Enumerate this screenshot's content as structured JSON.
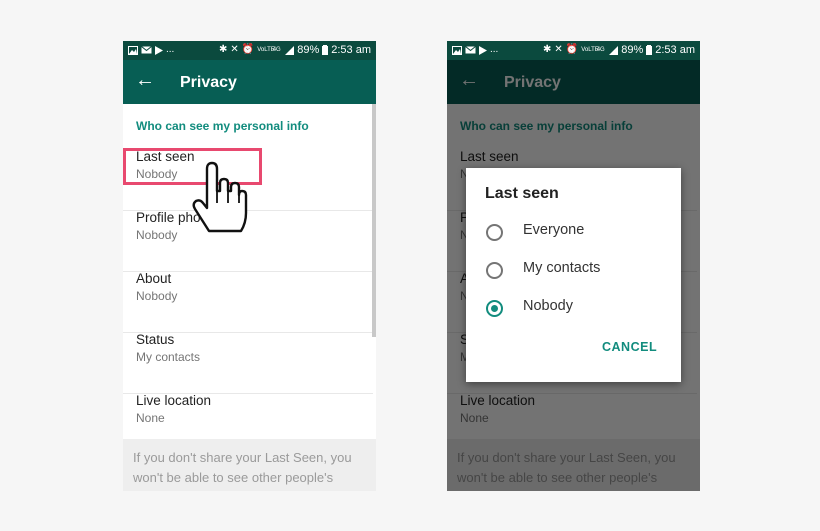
{
  "status_bar": {
    "battery": "89%",
    "time": "2:53 am",
    "left_icons": [
      "image-icon",
      "mail-icon",
      "play-store-icon"
    ],
    "overflow": "...",
    "right_icons": [
      "bluetooth-icon",
      "mute-icon",
      "alarm-icon",
      "volte-icon",
      "4g-icon",
      "signal-icon",
      "battery-icon"
    ],
    "volte": "VoLTE",
    "network": "4G"
  },
  "toolbar": {
    "title": "Privacy",
    "back_icon": "arrow-left-icon"
  },
  "privacy": {
    "section_header": "Who can see my personal info",
    "settings": [
      {
        "title": "Last seen",
        "value": "Nobody"
      },
      {
        "title": "Profile photo",
        "value": "Nobody"
      },
      {
        "title": "About",
        "value": "Nobody"
      },
      {
        "title": "Status",
        "value": "My contacts"
      },
      {
        "title": "Live location",
        "value": "None"
      }
    ],
    "footer_note": "If you don't share your Last Seen, you won't be able to see other people's"
  },
  "dialog": {
    "title": "Last seen",
    "options": [
      {
        "label": "Everyone",
        "selected": false
      },
      {
        "label": "My contacts",
        "selected": false
      },
      {
        "label": "Nobody",
        "selected": true
      }
    ],
    "cancel_label": "CANCEL"
  },
  "colors": {
    "status_bar": "#0b4a3e",
    "toolbar": "#075e54",
    "accent": "#128c7e",
    "highlight": "#e8496f"
  }
}
